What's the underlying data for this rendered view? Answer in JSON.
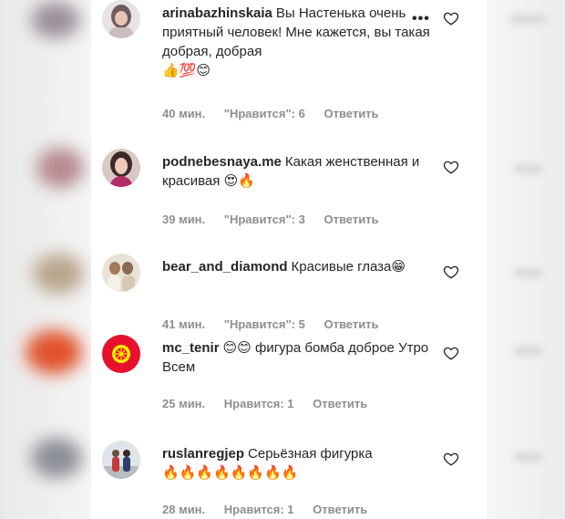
{
  "comments": [
    {
      "username": "arinabazhinskaia",
      "text": "Вы Настенька очень приятный человек! Мне кажется, вы такая добрая, добрая",
      "emoji": "👍💯😊",
      "time": "40 мин.",
      "likes": "\"Нравится\": 6",
      "reply": "Ответить"
    },
    {
      "username": "podnebesnaya.me",
      "text": "Какая женственная и красивая",
      "emoji": "😍🔥",
      "time": "39 мин.",
      "likes": "\"Нравится\": 3",
      "reply": "Ответить"
    },
    {
      "username": "bear_and_diamond",
      "text": "Красивые глаза",
      "emoji": "😁",
      "time": "41 мин.",
      "likes": "\"Нравится\": 5",
      "reply": "Ответить"
    },
    {
      "username": "mc_tenir",
      "text": "😊😊 фигура бомба доброе Утро Всем",
      "emoji": "",
      "time": "25 мин.",
      "likes": "Нравится: 1",
      "reply": "Ответить"
    },
    {
      "username": "ruslanregjep",
      "text": "Серьёзная фигурка",
      "emoji": "🔥🔥🔥🔥🔥🔥🔥🔥",
      "time": "28 мин.",
      "likes": "Нравится: 1",
      "reply": "Ответить"
    }
  ],
  "icons": {
    "like": "heart-outline-icon",
    "more": "more-options-icon"
  },
  "colors": {
    "text": "#262626",
    "meta": "#8e8e8e",
    "background": "#ffffff"
  }
}
